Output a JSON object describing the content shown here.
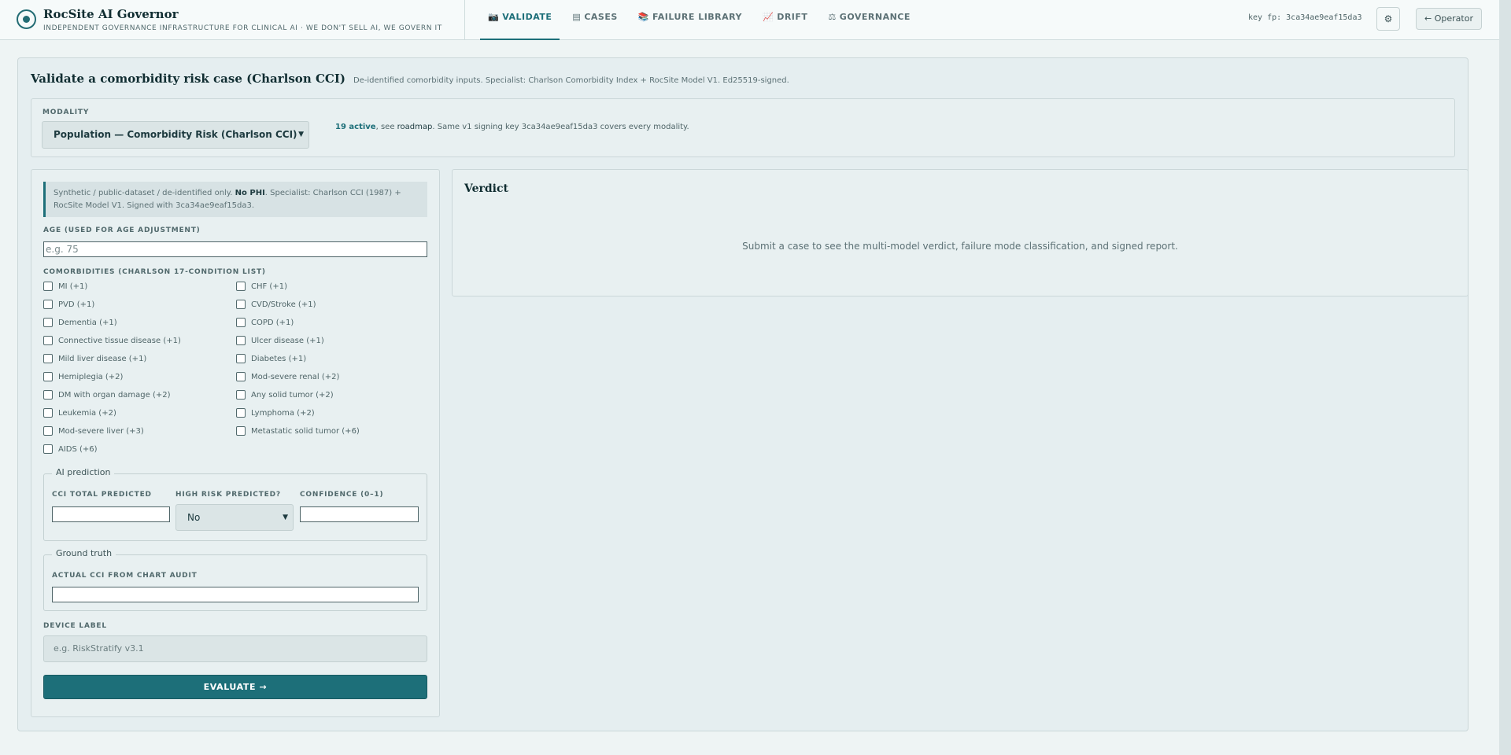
{
  "header": {
    "title": "RocSite AI Governor",
    "tagline": "INDEPENDENT GOVERNANCE INFRASTRUCTURE FOR CLINICAL AI · WE DON'T SELL AI, WE GOVERN IT",
    "tabs": [
      {
        "icon": "📷",
        "label": "VALIDATE",
        "active": true
      },
      {
        "icon": "▤",
        "label": "CASES"
      },
      {
        "icon": "📚",
        "label": "FAILURE LIBRARY"
      },
      {
        "icon": "📈",
        "label": "DRIFT"
      },
      {
        "icon": "⚖",
        "label": "GOVERNANCE"
      }
    ],
    "key_fp": "key fp: 3ca34ae9eaf15da3",
    "settings_icon": "⚙",
    "operator_label": "← Operator"
  },
  "main": {
    "title": "Validate a comorbidity risk case (Charlson CCI)",
    "subtitle": "De-identified comorbidity inputs. Specialist: Charlson Comorbidity Index + RocSite Model V1. Ed25519-signed."
  },
  "modality": {
    "label": "MODALITY",
    "selected": "Population — Comorbidity Risk (Charlson CCI)",
    "note_active": "19 active",
    "note_see": ", see ",
    "note_roadmap": "roadmap",
    "note_rest": ". Same v1 signing key 3ca34ae9eaf15da3 covers every modality."
  },
  "form": {
    "notice_pre": "Synthetic / public-dataset / de-identified only. ",
    "notice_bold": "No PHI",
    "notice_post": ". Specialist: Charlson CCI (1987) + RocSite Model V1. Signed with 3ca34ae9eaf15da3.",
    "age_label": "AGE (USED FOR AGE ADJUSTMENT)",
    "age_placeholder": "e.g. 75",
    "comorbidities_label": "COMORBIDITIES (CHARLSON 17-CONDITION LIST)",
    "comorbidities": [
      "MI (+1)",
      "CHF (+1)",
      "PVD (+1)",
      "CVD/Stroke (+1)",
      "Dementia (+1)",
      "COPD (+1)",
      "Connective tissue disease (+1)",
      "Ulcer disease (+1)",
      "Mild liver disease (+1)",
      "Diabetes (+1)",
      "Hemiplegia (+2)",
      "Mod-severe renal (+2)",
      "DM with organ damage (+2)",
      "Any solid tumor (+2)",
      "Leukemia (+2)",
      "Lymphoma (+2)",
      "Mod-severe liver (+3)",
      "Metastatic solid tumor (+6)",
      "AIDS (+6)"
    ],
    "ai_prediction": {
      "legend": "AI prediction",
      "cci_label": "CCI TOTAL PREDICTED",
      "high_risk_label": "HIGH RISK PREDICTED?",
      "high_risk_value": "No",
      "confidence_label": "CONFIDENCE (0–1)"
    },
    "ground_truth": {
      "legend": "Ground truth",
      "actual_label": "ACTUAL CCI FROM CHART AUDIT"
    },
    "device_label": "DEVICE LABEL",
    "device_placeholder": "e.g. RiskStratify v3.1",
    "evaluate_label": "EVALUATE →"
  },
  "verdict": {
    "title": "Verdict",
    "empty_text": "Submit a case to see the multi-model verdict, failure mode classification, and signed report."
  }
}
